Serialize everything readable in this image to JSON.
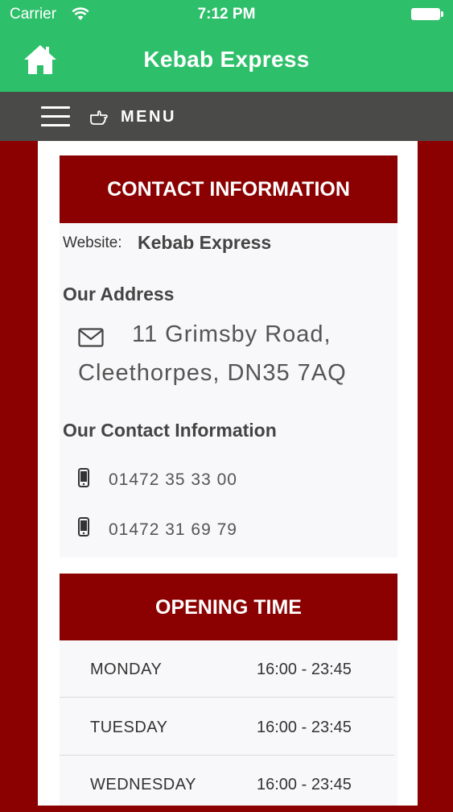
{
  "status_bar": {
    "carrier": "Carrier",
    "time": "7:12 PM"
  },
  "header": {
    "title": "Kebab Express",
    "home_icon": "home-icon"
  },
  "menu_bar": {
    "label": "MENU",
    "icons": [
      "hamburger-icon",
      "pointing-hand-icon"
    ]
  },
  "contact": {
    "heading": "CONTACT INFORMATION",
    "website_label": "Website:",
    "website_value": "Kebab Express",
    "address_title": "Our Address",
    "address_line1": "11 Grimsby Road,",
    "address_line2": "Cleethorpes, DN35 7AQ",
    "contact_title": "Our Contact Information",
    "phones": [
      "01472 35 33 00",
      "01472 31 69 79"
    ]
  },
  "opening": {
    "heading": "OPENING TIME",
    "rows": [
      {
        "day": "MONDAY",
        "time": "16:00 - 23:45"
      },
      {
        "day": "TUESDAY",
        "time": "16:00 - 23:45"
      },
      {
        "day": "WEDNESDAY",
        "time": "16:00 - 23:45"
      }
    ]
  },
  "colors": {
    "header_green": "#2ebf6a",
    "menu_gray": "#4a4a48",
    "accent_red": "#8b0000"
  }
}
